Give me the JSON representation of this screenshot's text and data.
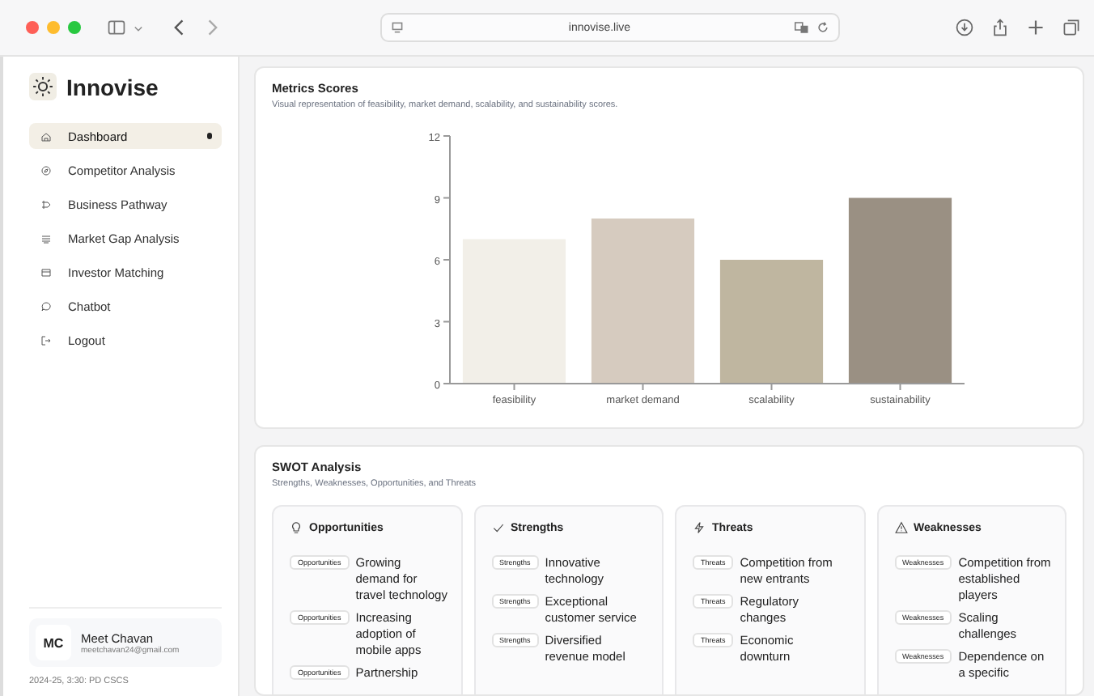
{
  "browser": {
    "url": "innovise.live"
  },
  "sidebar": {
    "brand": "Innovise",
    "items": [
      {
        "label": "Dashboard",
        "kind": "home",
        "selected": true
      },
      {
        "label": "Competitor Analysis",
        "kind": "compass",
        "selected": false
      },
      {
        "label": "Business Pathway",
        "kind": "route",
        "selected": false
      },
      {
        "label": "Market Gap Analysis",
        "kind": "layers",
        "selected": false
      },
      {
        "label": "Investor Matching",
        "kind": "card",
        "selected": false
      },
      {
        "label": "Chatbot",
        "kind": "chat",
        "selected": false
      },
      {
        "label": "Logout",
        "kind": "logout",
        "selected": false
      }
    ],
    "user": {
      "initials": "MC",
      "name": "Meet Chavan",
      "email": "meetchavan24@gmail.com"
    },
    "footer": "2024-25, 3:30: PD CSCS"
  },
  "metrics": {
    "title": "Metrics Scores",
    "subtitle": "Visual representation of feasibility, market demand, scalability, and sustainability scores.",
    "chart_data": {
      "type": "bar",
      "categories": [
        "feasibility",
        "market demand",
        "scalability",
        "sustainability"
      ],
      "values": [
        7,
        8,
        6,
        9
      ],
      "ylim": [
        0,
        12
      ],
      "yticks": [
        0,
        3,
        6,
        9,
        12
      ]
    }
  },
  "swot": {
    "title": "SWOT Analysis",
    "subtitle": "Strengths, Weaknesses, Opportunities, and Threats",
    "columns": [
      {
        "title": "Opportunities",
        "kind": "bulb",
        "items": [
          {
            "tag": "Opportunities",
            "text": "Growing demand for travel technology"
          },
          {
            "tag": "Opportunities",
            "text": "Increasing adoption of mobile apps"
          },
          {
            "tag": "Opportunities",
            "text": "Partnership"
          }
        ]
      },
      {
        "title": "Strengths",
        "kind": "check",
        "items": [
          {
            "tag": "Strengths",
            "text": "Innovative technology"
          },
          {
            "tag": "Strengths",
            "text": "Exceptional customer service"
          },
          {
            "tag": "Strengths",
            "text": "Diversified revenue model"
          }
        ]
      },
      {
        "title": "Threats",
        "kind": "bolt",
        "items": [
          {
            "tag": "Threats",
            "text": "Competition from new entrants"
          },
          {
            "tag": "Threats",
            "text": "Regulatory changes"
          },
          {
            "tag": "Threats",
            "text": "Economic downturn"
          }
        ]
      },
      {
        "title": "Weaknesses",
        "kind": "warning",
        "items": [
          {
            "tag": "Weaknesses",
            "text": "Competition from established players"
          },
          {
            "tag": "Weaknesses",
            "text": "Scaling challenges"
          },
          {
            "tag": "Weaknesses",
            "text": "Dependence on a specific"
          }
        ]
      }
    ]
  }
}
